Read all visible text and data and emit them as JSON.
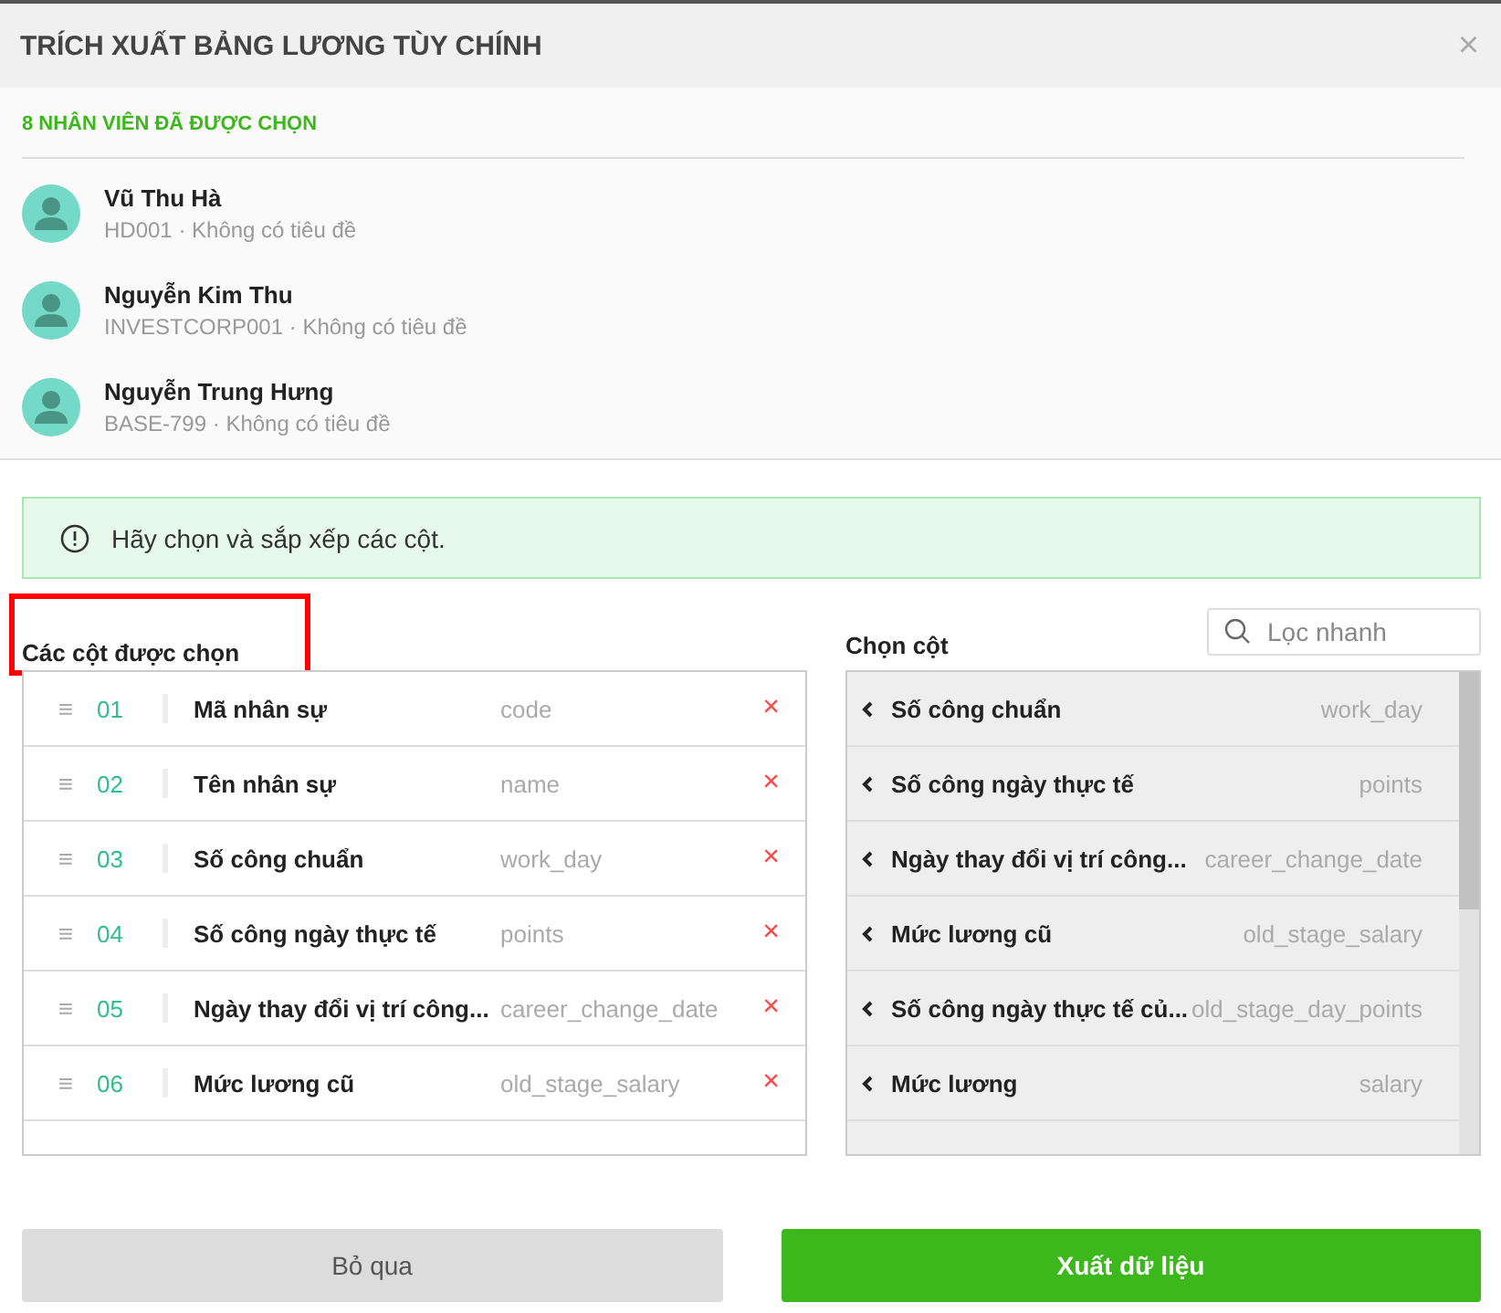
{
  "dialog": {
    "title": "TRÍCH XUẤT BẢNG LƯƠNG TÙY CHÍNH",
    "close": "×"
  },
  "selected_count": "8 NHÂN VIÊN ĐÃ ĐƯỢC CHỌN",
  "employees": [
    {
      "name": "Vũ Thu Hà",
      "detail": "HD001 · Không có tiêu đề"
    },
    {
      "name": "Nguyễn Kim Thu",
      "detail": "INVESTCORP001 · Không có tiêu đề"
    },
    {
      "name": "Nguyễn Trung Hưng",
      "detail": "BASE-799 · Không có tiêu đề"
    }
  ],
  "notice": "Hãy chọn và sắp xếp các cột.",
  "selected_columns": {
    "heading": "Các cột được chọn",
    "highlighted": true,
    "rows": [
      {
        "drag": "≡",
        "number": "01",
        "label": "Mã nhân sự",
        "key": "code",
        "remove": "×"
      },
      {
        "drag": "≡",
        "number": "02",
        "label": "Tên nhân sự",
        "key": "name",
        "remove": "×"
      },
      {
        "drag": "≡",
        "number": "03",
        "label": "Số công chuẩn",
        "key": "work_day",
        "remove": "×"
      },
      {
        "drag": "≡",
        "number": "04",
        "label": "Số công ngày thực tế",
        "key": "points",
        "remove": "×"
      },
      {
        "drag": "≡",
        "number": "05",
        "label": "Ngày thay đổi vị trí công...",
        "key": "career_change_date",
        "remove": "×"
      },
      {
        "drag": "≡",
        "number": "06",
        "label": "Mức lương cũ",
        "key": "old_stage_salary",
        "remove": "×"
      }
    ]
  },
  "available_columns": {
    "heading": "Chọn cột",
    "search": {
      "placeholder": "Lọc nhanh"
    },
    "rows": [
      {
        "label": "Số công chuẩn",
        "key": "work_day"
      },
      {
        "label": "Số công ngày thực tế",
        "key": "points"
      },
      {
        "label": "Ngày thay đổi vị trí công...",
        "key": "career_change_date"
      },
      {
        "label": "Mức lương cũ",
        "key": "old_stage_salary"
      },
      {
        "label": "Số công ngày thực tế củ...",
        "key": "old_stage_day_points"
      },
      {
        "label": "Mức lương",
        "key": "salary"
      }
    ]
  },
  "buttons": [
    {
      "label": "Bỏ qua",
      "kind": "secondary"
    },
    {
      "label": "Xuất dữ liệu",
      "kind": "primary"
    }
  ]
}
